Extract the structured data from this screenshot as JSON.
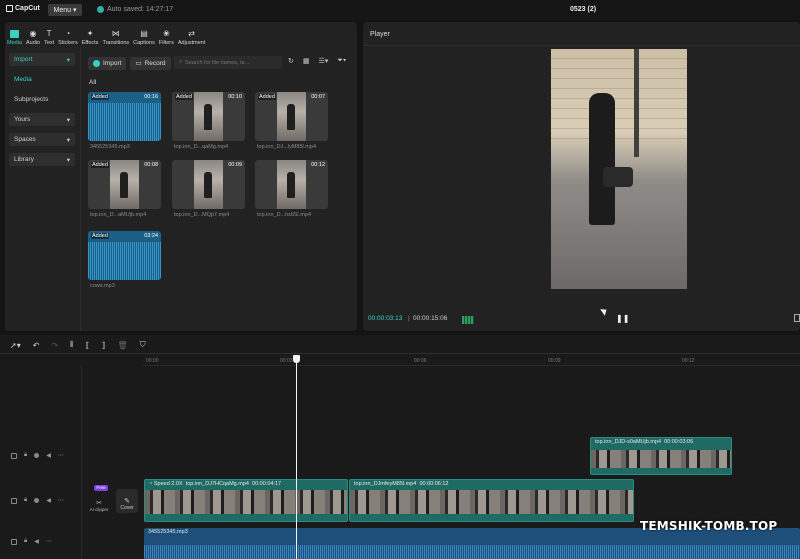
{
  "topbar": {
    "app_name": "CapCut",
    "menu_label": "Menu",
    "autosave_text": "Auto saved: 14:27:17",
    "project_title": "0523 (2)"
  },
  "tools": [
    {
      "label": "Media",
      "icon": "media-icon",
      "active": true
    },
    {
      "label": "Audio",
      "icon": "audio-icon"
    },
    {
      "label": "Text",
      "icon": "text-icon"
    },
    {
      "label": "Stickers",
      "icon": "stickers-icon"
    },
    {
      "label": "Effects",
      "icon": "effects-icon"
    },
    {
      "label": "Transitions",
      "icon": "transitions-icon"
    },
    {
      "label": "Captions",
      "icon": "captions-icon"
    },
    {
      "label": "Filters",
      "icon": "filters-icon"
    },
    {
      "label": "Adjustment",
      "icon": "adjustment-icon"
    }
  ],
  "sidebar": {
    "items": [
      {
        "label": "Import",
        "chevron": true
      },
      {
        "label": "Media"
      },
      {
        "label": "Subprojects"
      },
      {
        "label": "Yours",
        "chevron": true
      },
      {
        "label": "Spaces",
        "chevron": true
      },
      {
        "label": "Library",
        "chevron": true
      }
    ]
  },
  "media": {
    "import_label": "Import",
    "record_label": "Record",
    "search_placeholder": "Search for file names, te...",
    "filter_label": "All",
    "items": [
      {
        "badge": "Added",
        "duration": "00:16",
        "name": "345525345.mp3",
        "type": "audio"
      },
      {
        "badge": "Added",
        "duration": "00:10",
        "name": "top.inn_D...qaMg.mp4",
        "type": "video"
      },
      {
        "badge": "Added",
        "duration": "00:07",
        "name": "top.inn_DJ...lyM85l.mp4",
        "type": "video"
      },
      {
        "badge": "Added",
        "duration": "00:08",
        "name": "top.inn_D...aMUjb.mp4",
        "type": "video"
      },
      {
        "badge": "Added",
        "duration": "00:09",
        "name": "top.inn_D...MQp7.mp4",
        "type": "video"
      },
      {
        "badge": "Added",
        "duration": "00:12",
        "name": "top.inn_D...hsl2E.mp4",
        "type": "video"
      },
      {
        "badge": "Added",
        "duration": "03:24",
        "name": "cows.mp3",
        "type": "audio"
      }
    ]
  },
  "player": {
    "label": "Player",
    "current_time": "00:00:03:13",
    "total_time": "00:00:15:06",
    "time_separator": "|"
  },
  "timeline": {
    "ruler_ticks": [
      "00:00",
      "00:03",
      "00:06",
      "00:09",
      "00:12"
    ],
    "clips": {
      "upper_video": {
        "name": "top.inn_DJD-s0aMUjb.mp4",
        "duration": "00:00:03:06"
      },
      "main_video_1": {
        "speed": "Speed 2.0X",
        "name": "top.inn_DJ7HCqaMg.mp4",
        "duration": "00:00:04:17"
      },
      "main_video_2": {
        "name": "top.inn_DJmfeyM85l.mp4",
        "duration": "00:00:06:12"
      },
      "audio": {
        "name": "345525345.mp3"
      }
    },
    "ai_clipper_label": "AI clipper",
    "free_badge": "Free",
    "cover_label": "Cover"
  },
  "watermark": "TEMSHIK-TOMB.TOP",
  "colors": {
    "accent": "#37d2c4",
    "video_clip": "#1f6b64",
    "audio_clip": "#1e4f7a",
    "free_badge": "#7b3fe4"
  }
}
